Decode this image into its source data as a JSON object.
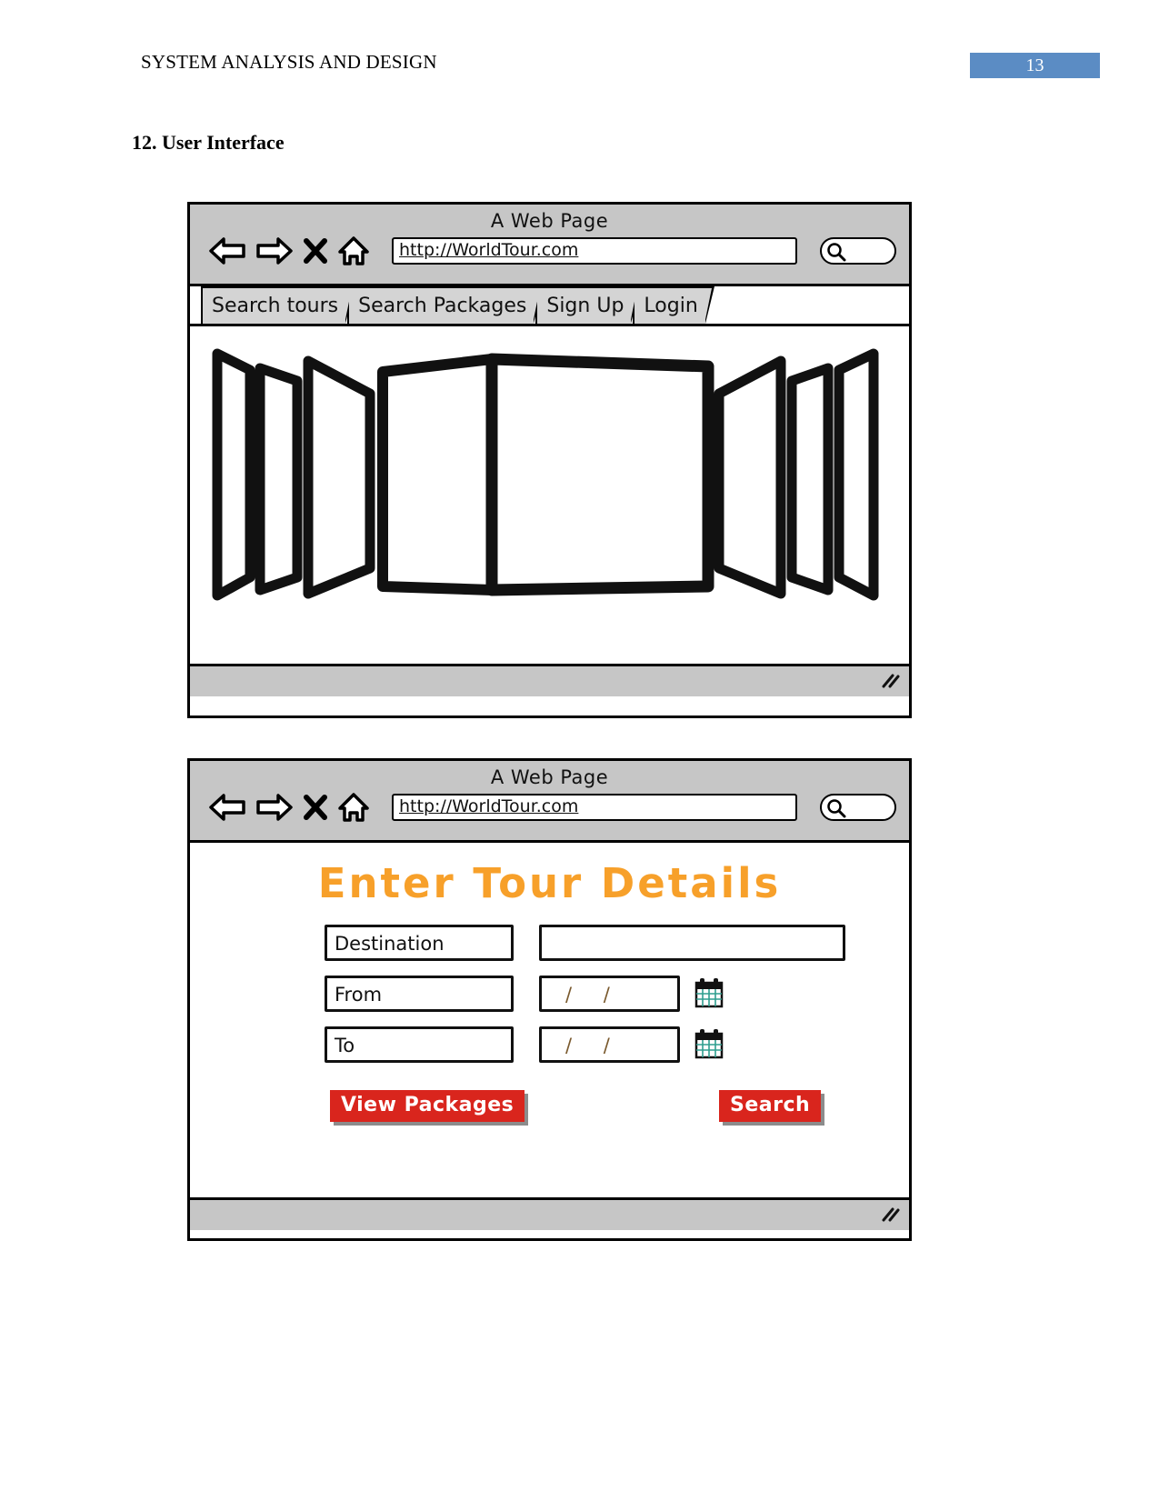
{
  "document": {
    "header_title": "SYSTEM ANALYSIS AND DESIGN",
    "page_number": "13",
    "page_badge_color": "#5b8cc4",
    "section_heading": "12. User Interface"
  },
  "browser_one": {
    "window_title": "A Web Page",
    "url": "http://WorldTour.com",
    "nav": {
      "back_icon": "back-arrow-icon",
      "forward_icon": "forward-arrow-icon",
      "stop_icon": "close-x-icon",
      "home_icon": "home-icon",
      "search_icon": "magnifier-icon"
    },
    "tabs": [
      {
        "label": "Search tours"
      },
      {
        "label": "Search Packages"
      },
      {
        "label": "Sign Up"
      },
      {
        "label": "Login"
      }
    ],
    "content": {
      "widget": "image-carousel-coverflow",
      "slide_count": 7
    },
    "statusbar": {
      "resize_handle": "resize-grip-icon"
    }
  },
  "browser_two": {
    "window_title": "A Web Page",
    "url": "http://WorldTour.com",
    "nav": {
      "back_icon": "back-arrow-icon",
      "forward_icon": "forward-arrow-icon",
      "stop_icon": "close-x-icon",
      "home_icon": "home-icon",
      "search_icon": "magnifier-icon"
    },
    "form": {
      "title": "Enter Tour Details",
      "title_color": "#f7a02a",
      "rows": [
        {
          "label": "Destination",
          "value": "",
          "placeholder": "",
          "has_calendar": false
        },
        {
          "label": "From",
          "value": "/  /",
          "placeholder": "/  /",
          "has_calendar": true,
          "calendar_icon": "calendar-icon"
        },
        {
          "label": "To",
          "value": "/  /",
          "placeholder": "/  /",
          "has_calendar": true,
          "calendar_icon": "calendar-icon"
        }
      ],
      "buttons": {
        "view_packages": "View Packages",
        "search": "Search",
        "color": "#d9251d"
      }
    },
    "statusbar": {
      "resize_handle": "resize-grip-icon"
    }
  }
}
